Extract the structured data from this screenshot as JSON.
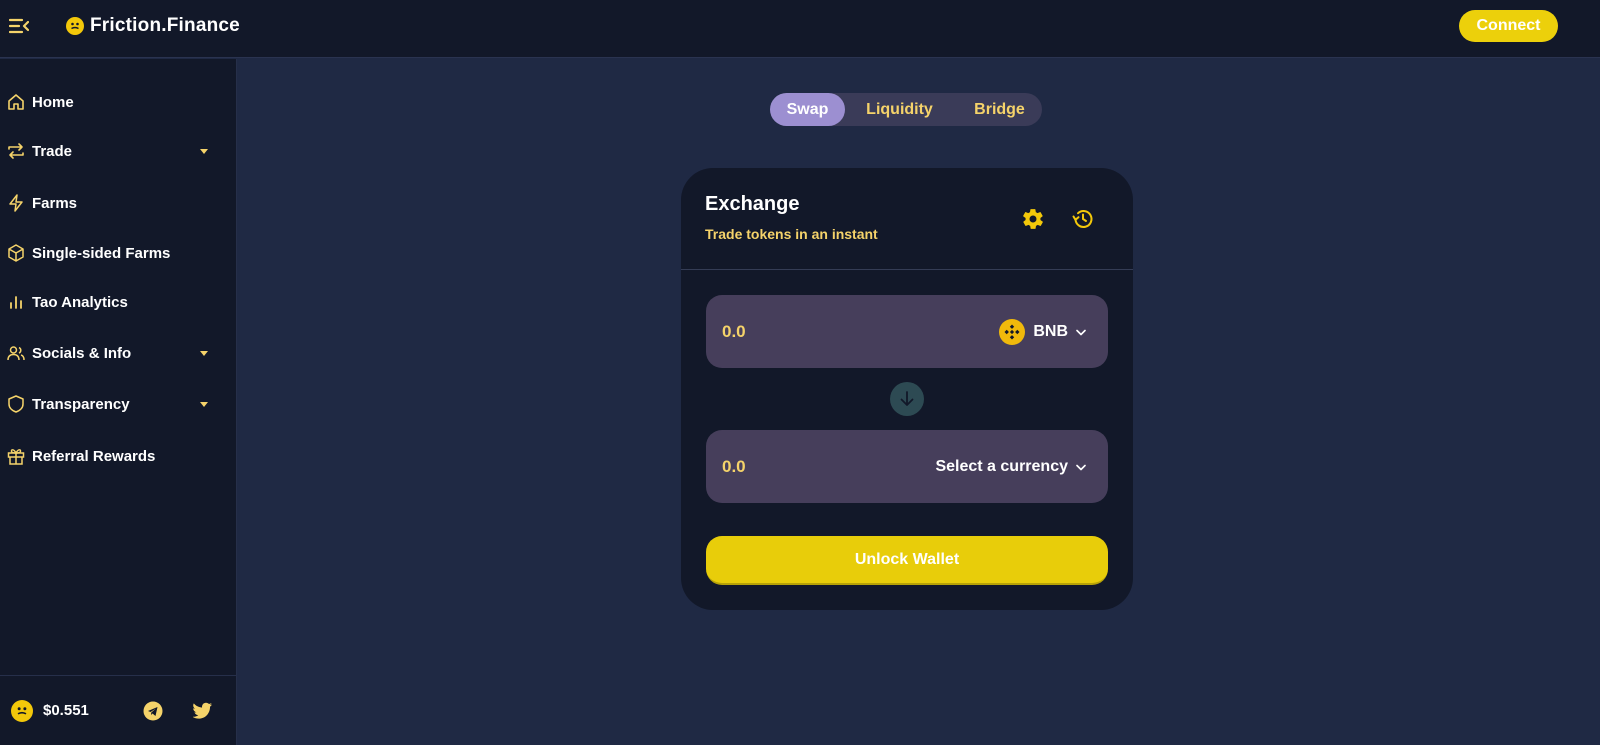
{
  "header": {
    "brand_name": "Friction.Finance",
    "connect_label": "Connect",
    "menu_icon": "menu-collapse-icon",
    "logo_icon": "friction-logo-icon"
  },
  "sidebar": {
    "items": [
      {
        "label": "Home",
        "icon": "home-icon",
        "has_dropdown": false
      },
      {
        "label": "Trade",
        "icon": "swap-arrows-icon",
        "has_dropdown": true
      },
      {
        "label": "Farms",
        "icon": "lightning-icon",
        "has_dropdown": false
      },
      {
        "label": "Single-sided Farms",
        "icon": "box-icon",
        "has_dropdown": false
      },
      {
        "label": "Tao Analytics",
        "icon": "bar-chart-icon",
        "has_dropdown": false
      },
      {
        "label": "Socials & Info",
        "icon": "users-icon",
        "has_dropdown": true
      },
      {
        "label": "Transparency",
        "icon": "shield-icon",
        "has_dropdown": true
      },
      {
        "label": "Referral Rewards",
        "icon": "gift-icon",
        "has_dropdown": false
      }
    ],
    "footer": {
      "price": "$0.551",
      "telegram_icon": "telegram-icon",
      "twitter_icon": "twitter-icon"
    }
  },
  "tabs": [
    {
      "label": "Swap",
      "active": true
    },
    {
      "label": "Liquidity",
      "active": false
    },
    {
      "label": "Bridge",
      "active": false
    }
  ],
  "exchange": {
    "title": "Exchange",
    "subtitle": "Trade tokens in an instant",
    "settings_icon": "gear-icon",
    "history_icon": "history-icon",
    "from": {
      "placeholder": "0.0",
      "currency": "BNB"
    },
    "to": {
      "placeholder": "0.0",
      "currency": "Select a currency"
    },
    "unlock_label": "Unlock Wallet"
  },
  "colors": {
    "accent": "#ecd00b",
    "label_yellow": "#f5d36a",
    "active_tab": "#9c8fd1",
    "background": "#1f2944",
    "panel": "#121829",
    "input_bg": "#463e5b"
  }
}
